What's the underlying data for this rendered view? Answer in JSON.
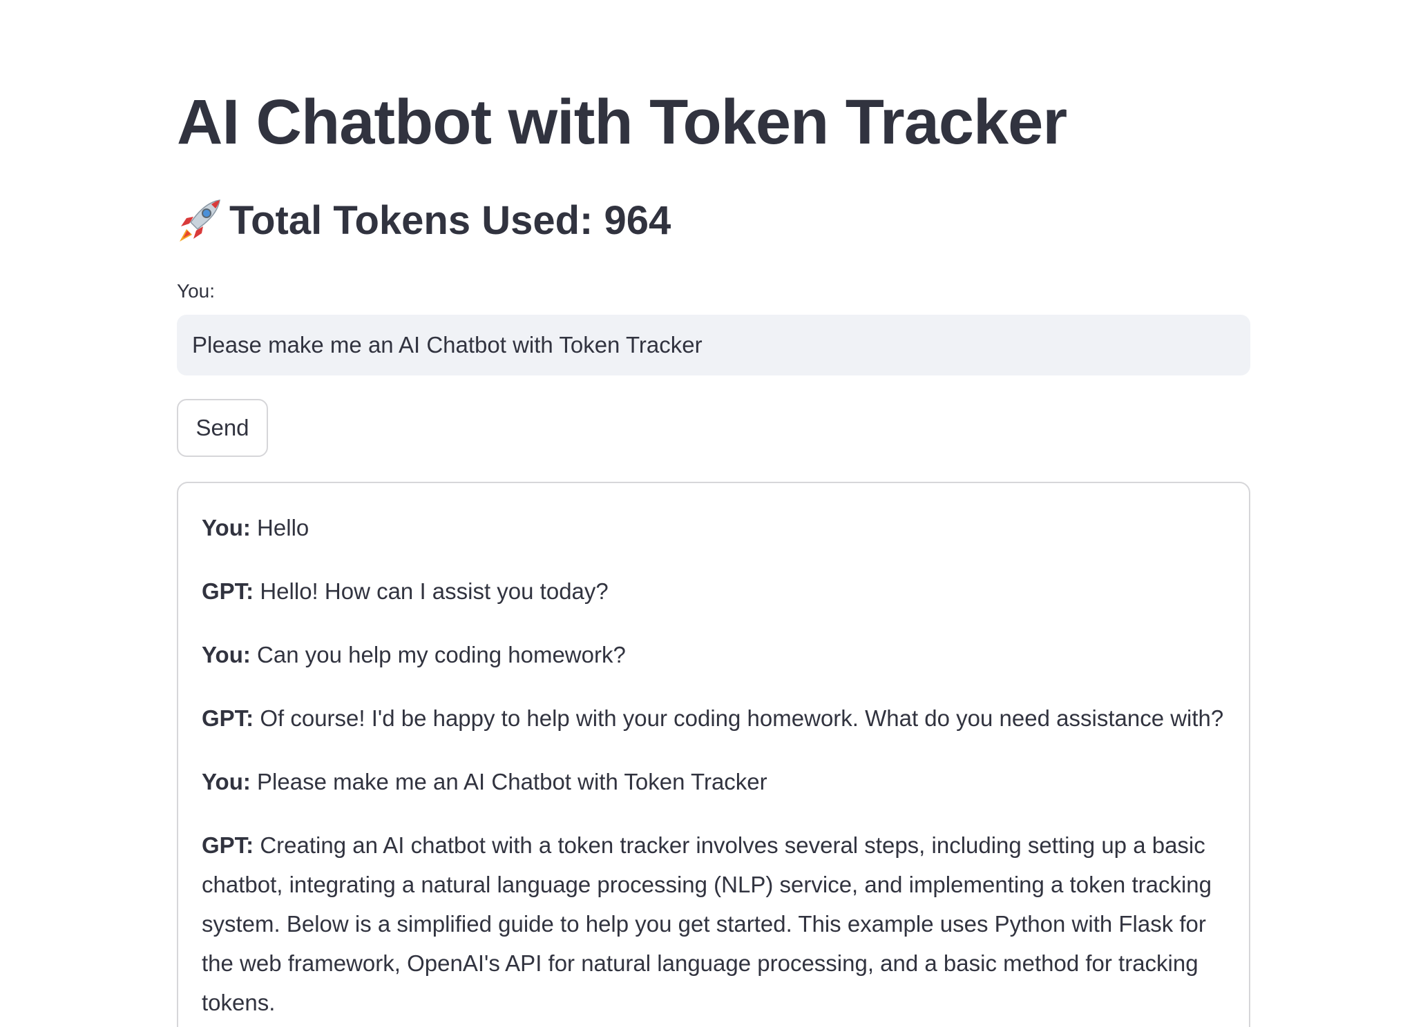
{
  "app": {
    "title": "AI Chatbot with Token Tracker"
  },
  "tokens": {
    "label": "Total Tokens Used: 964",
    "icon": "rocket-icon"
  },
  "input": {
    "label": "You:",
    "value": "Please make me an AI Chatbot with Token Tracker"
  },
  "send_button": {
    "label": "Send"
  },
  "chat": {
    "messages": [
      {
        "speaker": "You:",
        "text": "Hello"
      },
      {
        "speaker": "GPT:",
        "text": "Hello! How can I assist you today?"
      },
      {
        "speaker": "You:",
        "text": "Can you help my coding homework?"
      },
      {
        "speaker": "GPT:",
        "text": "Of course! I'd be happy to help with your coding homework. What do you need assistance with?"
      },
      {
        "speaker": "You:",
        "text": "Please make me an AI Chatbot with Token Tracker"
      },
      {
        "speaker": "GPT:",
        "text": "Creating an AI chatbot with a token tracker involves several steps, including setting up a basic chatbot, integrating a natural language processing (NLP) service, and implementing a token tracking system. Below is a simplified guide to help you get started. This example uses Python with Flask for the web framework, OpenAI's API for natural language processing, and a basic method for tracking tokens."
      }
    ]
  },
  "colors": {
    "text": "#31333f",
    "input_background": "#f0f2f6",
    "border": "#d6d6d9",
    "background": "#ffffff"
  }
}
